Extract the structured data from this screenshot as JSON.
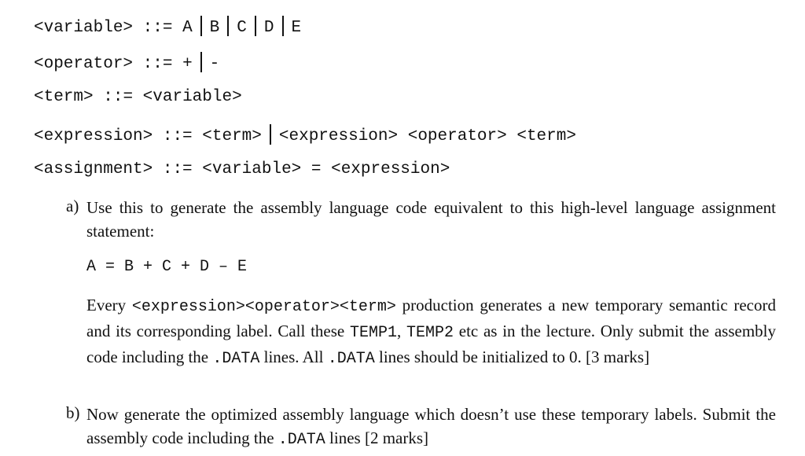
{
  "grammar": {
    "variable": {
      "lhs": "<variable>",
      "op": "::=",
      "alts": [
        "A",
        "B",
        "C",
        "D",
        "E"
      ]
    },
    "operator": {
      "lhs": "<operator>",
      "op": "::=",
      "alts": [
        "+",
        "-"
      ]
    },
    "term": {
      "lhs": "<term>",
      "op": "::=",
      "rhs": "<variable>"
    },
    "expression": {
      "lhs": "<expression>",
      "op": "::=",
      "alt1": "<term>",
      "alt2": "<expression> <operator> <term>"
    },
    "assignment": {
      "lhs": "<assignment>",
      "op": "::=",
      "rhs": "<variable> = <expression>"
    }
  },
  "part_a": {
    "label": "a)",
    "intro": "Use this to generate the assembly language code equivalent to this high-level language assignment statement:",
    "statement": "A = B + C + D – E",
    "p1_pre": "Every ",
    "p1_code": "<expression><operator><term>",
    "p1_post": " production generates a new temporary semantic record and its corresponding label. Call these ",
    "temp1": "TEMP1",
    "comma": ", ",
    "temp2": "TEMP2",
    "p1_end": " etc as in the lecture. Only submit the assembly code including the ",
    "data1": ".DATA",
    "p1_mid": " lines. All ",
    "data2": ".DATA",
    "p1_tail": " lines should be initialized to 0. [3 marks]"
  },
  "part_b": {
    "label": "b)",
    "text_pre": "Now generate the optimized assembly language which doesn’t use these temporary labels. Submit the assembly code including the ",
    "data": ".DATA",
    "text_post": " lines [2 marks]"
  }
}
